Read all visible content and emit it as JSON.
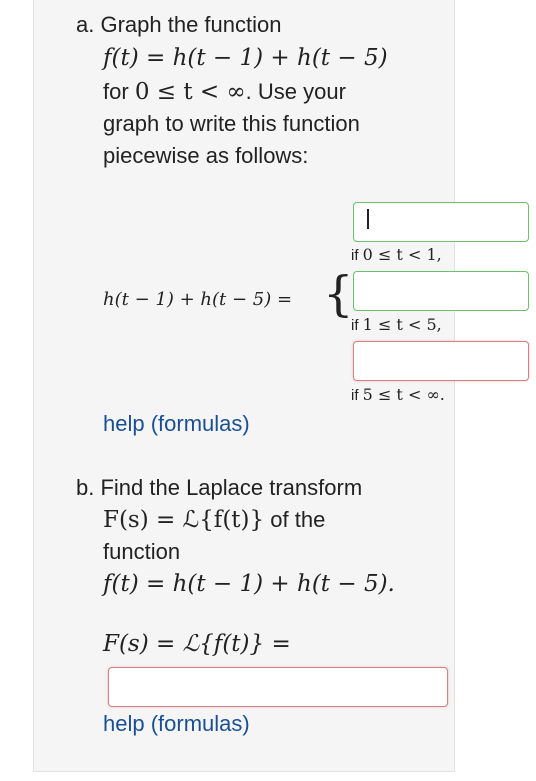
{
  "part_a": {
    "intro": "a. Graph the function",
    "function_expr": "f(t) = h(t − 1) + h(t − 5)",
    "for_label": "for",
    "domain_expr": "0 ≤ t < ∞",
    "after_domain": ". Use your",
    "line_3": "graph to write this function",
    "line_4": "piecewise as follows:",
    "lhs_expr": "h(t − 1) + h(t − 5) =",
    "cases": [
      {
        "condition_prefix": "if",
        "condition_expr": "0 ≤ t < 1,",
        "input_value": "",
        "state": "correct"
      },
      {
        "condition_prefix": "if",
        "condition_expr": "1 ≤ t < 5,",
        "input_value": "",
        "state": "correct"
      },
      {
        "condition_prefix": "if",
        "condition_expr": "5 ≤ t < ∞.",
        "input_value": "",
        "state": "incorrect"
      }
    ],
    "help_link": "help (formulas)"
  },
  "part_b": {
    "intro": "b. Find the Laplace transform",
    "transform_expr": "F(s) = ℒ{f(t)}",
    "of_the": "of the",
    "line_3": "function",
    "function_expr": "f(t) = h(t − 1) + h(t − 5).",
    "answer_prompt": "F(s) = ℒ{f(t)} =",
    "answer_value": "",
    "help_link": "help (formulas)"
  },
  "colors": {
    "link": "#1a4f94",
    "correct_border": "#6cbf6c",
    "incorrect_border": "#d98080",
    "card_background": "#f5f5f5"
  }
}
